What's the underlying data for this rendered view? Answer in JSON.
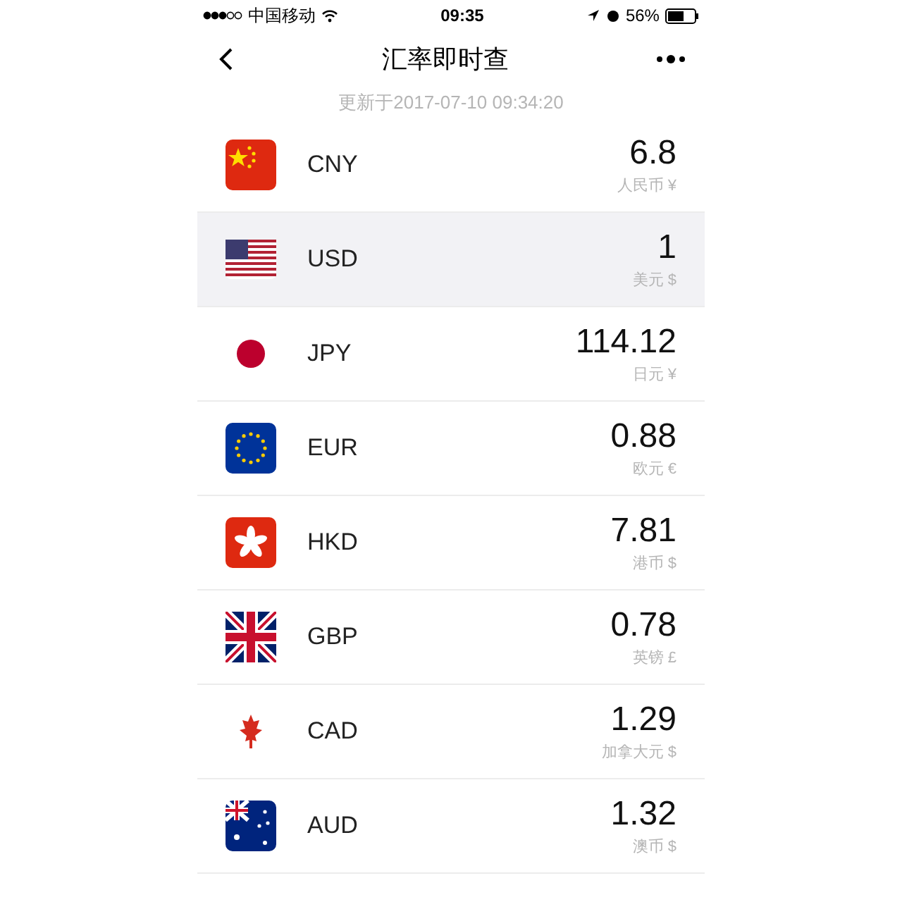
{
  "status_bar": {
    "carrier": "中国移动",
    "time": "09:35",
    "battery": "56%"
  },
  "nav": {
    "title": "汇率即时查"
  },
  "updated": "更新于2017-07-10 09:34:20",
  "rates": [
    {
      "kind": "cn",
      "code": "CNY",
      "value": "6.8",
      "name": "人民币 ¥",
      "selected": false
    },
    {
      "kind": "us",
      "code": "USD",
      "value": "1",
      "name": "美元 $",
      "selected": true
    },
    {
      "kind": "jp",
      "code": "JPY",
      "value": "114.12",
      "name": "日元 ¥",
      "selected": false
    },
    {
      "kind": "eu",
      "code": "EUR",
      "value": "0.88",
      "name": "欧元 €",
      "selected": false
    },
    {
      "kind": "hk",
      "code": "HKD",
      "value": "7.81",
      "name": "港币 $",
      "selected": false
    },
    {
      "kind": "gb",
      "code": "GBP",
      "value": "0.78",
      "name": "英镑 £",
      "selected": false
    },
    {
      "kind": "ca",
      "code": "CAD",
      "value": "1.29",
      "name": "加拿大元 $",
      "selected": false
    },
    {
      "kind": "au",
      "code": "AUD",
      "value": "1.32",
      "name": "澳币 $",
      "selected": false
    }
  ]
}
